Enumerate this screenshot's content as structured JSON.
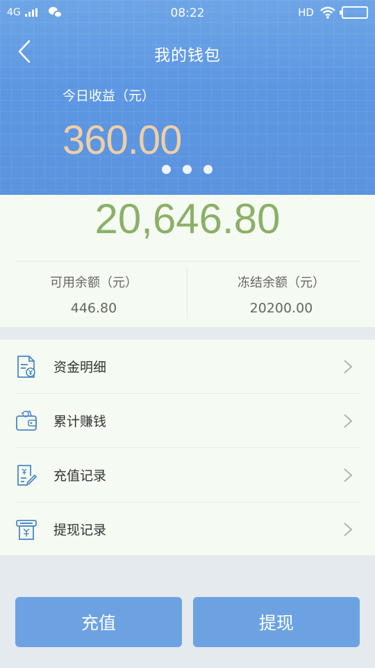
{
  "status_bar": {
    "network": "4G",
    "time": "08:22",
    "hd": "HD"
  },
  "header": {
    "title": "我的钱包",
    "today_label": "今日收益（元）",
    "today_value": "360.00",
    "carousel_count": 3
  },
  "balance": {
    "total": "20,646.80",
    "available_label": "可用余额（元）",
    "available_value": "446.80",
    "frozen_label": "冻结余额（元）",
    "frozen_value": "20200.00"
  },
  "menu": {
    "items": [
      {
        "label": "资金明细",
        "icon": "fund-details-icon"
      },
      {
        "label": "累计赚钱",
        "icon": "wallet-icon"
      },
      {
        "label": "充值记录",
        "icon": "recharge-record-icon"
      },
      {
        "label": "提现记录",
        "icon": "withdraw-record-icon"
      }
    ]
  },
  "actions": {
    "recharge_label": "充值",
    "withdraw_label": "提现"
  },
  "colors": {
    "header_blue": "#5d97e2",
    "today_value": "#efcfa8",
    "total_green": "#8bb067",
    "button_blue": "#6da2e2",
    "icon_blue": "#4a86c6"
  }
}
